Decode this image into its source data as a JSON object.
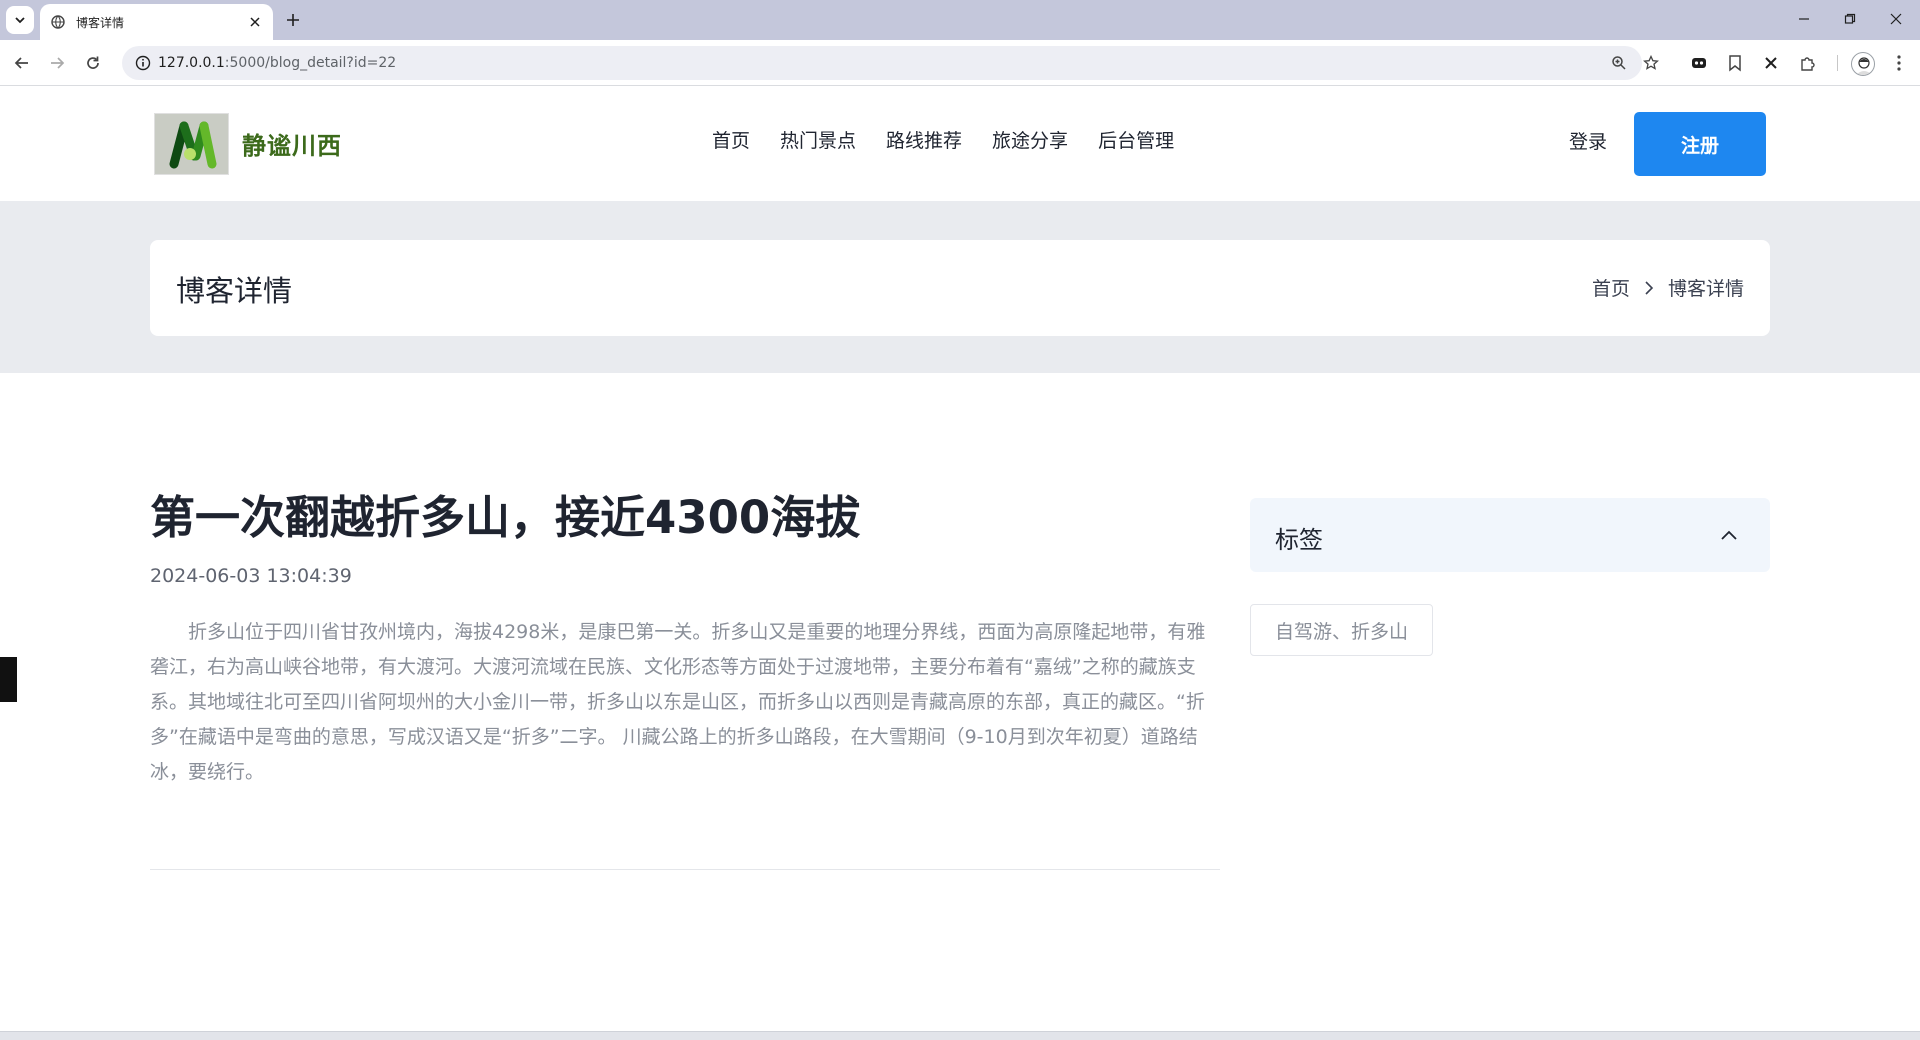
{
  "browser": {
    "tab_title": "博客详情",
    "url_host": "127.0.0.1",
    "url_rest": ":5000/blog_detail?id=22"
  },
  "site": {
    "logo_text": "静谧川西",
    "nav": [
      {
        "label": "首页"
      },
      {
        "label": "热门景点"
      },
      {
        "label": "路线推荐"
      },
      {
        "label": "旅途分享"
      },
      {
        "label": "后台管理"
      }
    ],
    "login_label": "登录",
    "register_label": "注册"
  },
  "breadcrumb": {
    "page_title": "博客详情",
    "home": "首页",
    "current": "博客详情"
  },
  "article": {
    "title": "第一次翻越折多山，接近4300海拔",
    "date": "2024-06-03 13:04:39",
    "body": "折多山位于四川省甘孜州境内，海拔4298米，是康巴第一关。折多山又是重要的地理分界线，西面为高原隆起地带，有雅砻江，右为高山峡谷地带，有大渡河。大渡河流域在民族、文化形态等方面处于过渡地带，主要分布着有“嘉绒”之称的藏族支系。其地域往北可至四川省阿坝州的大小金川一带，折多山以东是山区，而折多山以西则是青藏高原的东部，真正的藏区。“折多”在藏语中是弯曲的意思，写成汉语又是“折多”二字。 川藏公路上的折多山路段，在大雪期间（9-10月到次年初夏）道路结冰，要绕行。"
  },
  "sidebar": {
    "tags_title": "标签",
    "tags": [
      "自驾游、折多山"
    ]
  },
  "colors": {
    "primary": "#1e87f0",
    "logo_green": "#3c6a1b",
    "band_bg": "#e9ebef",
    "tag_panel_bg": "#f1f6fc"
  }
}
